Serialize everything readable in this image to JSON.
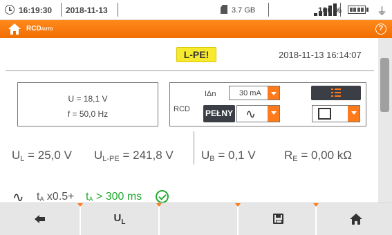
{
  "status_bar": {
    "time": "16:19:30",
    "date": "2018-11-13",
    "storage": "3.7 GB",
    "battery": "100 %"
  },
  "header": {
    "title": "RCD",
    "title_sub": "AUTO"
  },
  "main": {
    "alert": "L-PE!",
    "datetime": "2018-11-13 16:14:07",
    "voltage": "U = 18,1 V",
    "frequency": "f = 50,0 Hz",
    "rcd": {
      "label": "RCD",
      "idn_label": "IΔn",
      "idn_value": "30 mA",
      "mode_button": "PEŁNY",
      "waveform_symbol": "∿"
    },
    "results": {
      "ul_sym": "U",
      "ul_sub": "L",
      "ul_val": " = 25,0 V",
      "ulpe_sym": "U",
      "ulpe_sub": "L-PE",
      "ulpe_val": " = 241,8 V",
      "ub_sym": "U",
      "ub_sub": "B",
      "ub_val": " = 0,1 V",
      "re_sym": "R",
      "re_sub": "E",
      "re_val": " = 0,00 kΩ"
    },
    "test_row": {
      "wave": "∿",
      "t_sym": "t",
      "t_sub": "A",
      "mult": " x0.5+",
      "t2_sym": "t",
      "t2_sub": "A",
      "t2_val": " > 300 ms"
    }
  },
  "footer": {
    "ul_label": "U",
    "ul_sub": "L"
  },
  "colors": {
    "accent": "#f26d00",
    "ok": "#22aa30",
    "alert": "#f7ea2e",
    "button_dark": "#3b3e45"
  },
  "scrollbar": {
    "position_fraction": 0.18
  }
}
